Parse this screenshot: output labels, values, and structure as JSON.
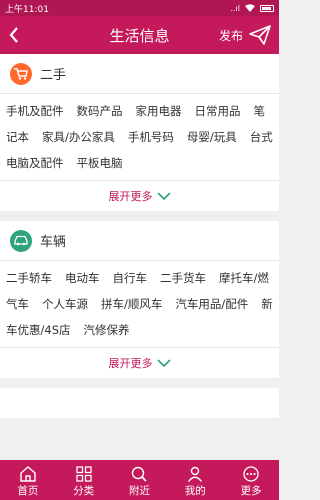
{
  "status": {
    "time": "上午11:01",
    "signal": "..ıl"
  },
  "nav": {
    "title": "生活信息",
    "publish": "发布"
  },
  "sections": [
    {
      "title": "二手",
      "icon": "cart-icon",
      "color": "#ff6a2c",
      "tags": [
        "手机及配件",
        "数码产品",
        "家用电器",
        "日常用品",
        "笔记本",
        "家具/办公家具",
        "手机号码",
        "母婴/玩具",
        "台式电脑及配件",
        "平板电脑"
      ],
      "expand": "展开更多"
    },
    {
      "title": "车辆",
      "icon": "car-icon",
      "color": "#2fa37a",
      "tags": [
        "二手轿车",
        "电动车",
        "自行车",
        "二手货车",
        "摩托车/燃气车",
        "个人车源",
        "拼车/顺风车",
        "汽车用品/配件",
        "新车优惠/4S店",
        "汽修保养"
      ],
      "expand": "展开更多"
    }
  ],
  "tabs": [
    {
      "label": "首页",
      "icon": "home-icon"
    },
    {
      "label": "分类",
      "icon": "category-grid-icon"
    },
    {
      "label": "附近",
      "icon": "search-nearby-icon"
    },
    {
      "label": "我的",
      "icon": "user-icon"
    },
    {
      "label": "更多",
      "icon": "more-dots-icon"
    }
  ],
  "colors": {
    "brand": "#c4195b",
    "status_bar": "#b01652"
  }
}
